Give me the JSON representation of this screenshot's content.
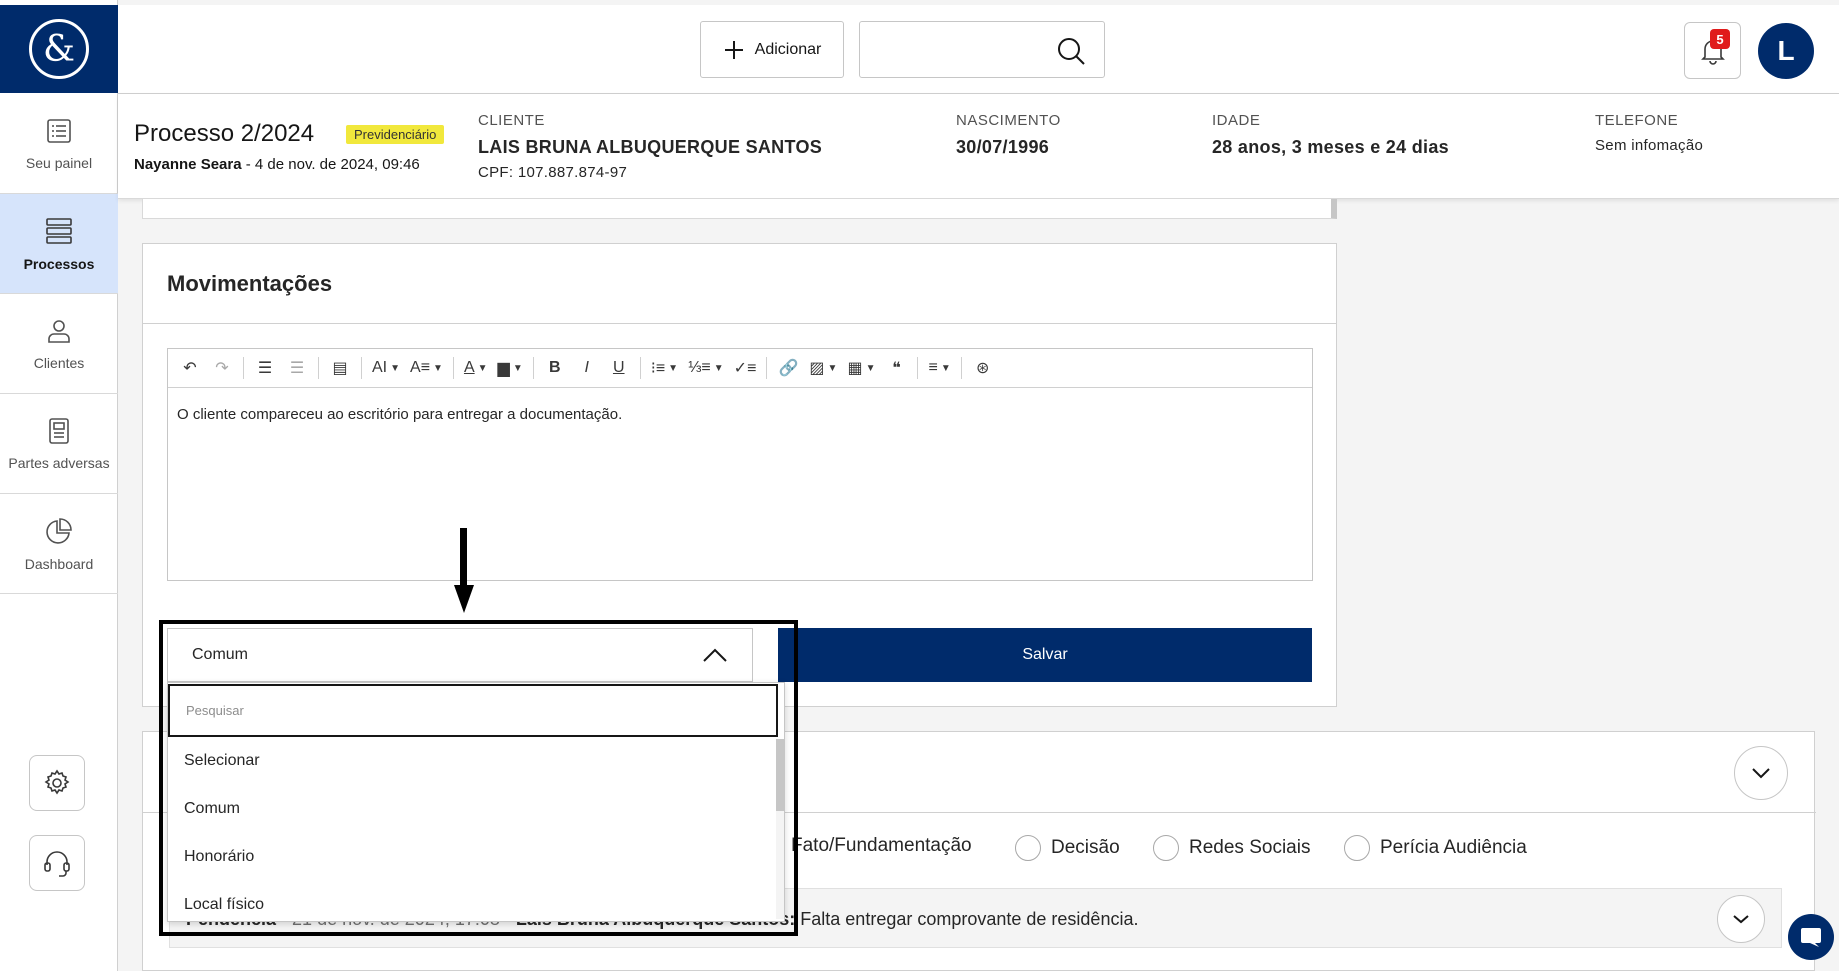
{
  "sidebar": {
    "logo": "&",
    "items": [
      {
        "label": "Seu painel",
        "icon": "list-icon"
      },
      {
        "label": "Processos",
        "icon": "layers-icon"
      },
      {
        "label": "Clientes",
        "icon": "user-icon"
      },
      {
        "label": "Partes adversas",
        "icon": "document-icon"
      },
      {
        "label": "Dashboard",
        "icon": "pie-chart-icon"
      }
    ],
    "settings_icon": "gear-icon",
    "support_icon": "headset-icon"
  },
  "topbar": {
    "add_label": "Adicionar",
    "search_placeholder": "",
    "notifications_count": "5",
    "avatar_initial": "L"
  },
  "process": {
    "title": "Processo 2/2024",
    "tag": "Previdenciário",
    "author": "Nayanne Seara",
    "date": " - 4 de nov. de 2024, 09:46",
    "client_label": "CLIENTE",
    "client_name": "LAIS BRUNA ALBUQUERQUE SANTOS",
    "client_cpf": "CPF: 107.887.874-97",
    "birth_label": "NASCIMENTO",
    "birth_value": "30/07/1996",
    "age_label": "IDADE",
    "age_value": "28 anos, 3 meses e 24 dias",
    "phone_label": "TELEFONE",
    "phone_value": "Sem infomação"
  },
  "movimentacoes": {
    "title": "Movimentações",
    "editor_text": "O cliente compareceu ao escritório para entregar a documentação.",
    "type_selected": "Comum",
    "save_label": "Salvar",
    "dropdown": {
      "search_placeholder": "Pesquisar",
      "options": [
        "Selecionar",
        "Comum",
        "Honorário",
        "Local físico"
      ]
    }
  },
  "filters": {
    "options": [
      "Fato/Fundamentação",
      "Decisão",
      "Redes Sociais",
      "Perícia Audiência"
    ]
  },
  "pendencia": {
    "label": "Pendência",
    "date": " - 21 de nov. de 2024, 17:08 - ",
    "author": "Lais Bruna Albuquerque Santos:",
    "text": "Falta entregar comprovante de residência."
  },
  "colors": {
    "primary": "#002b6b",
    "tag": "#f1e83c",
    "badge": "#e01b1b",
    "active_nav": "#d6e4fb"
  }
}
